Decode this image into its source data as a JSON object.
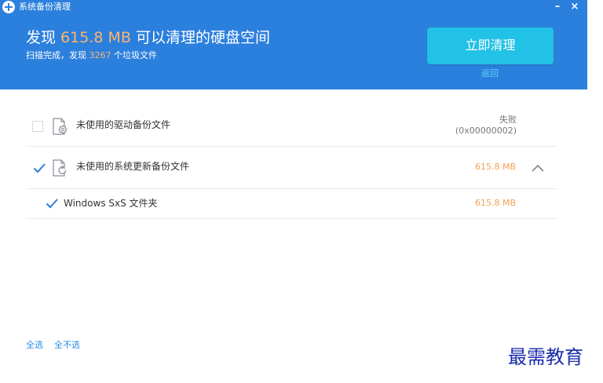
{
  "window": {
    "title": "系统备份清理",
    "minimize": "–",
    "close": "×"
  },
  "summary": {
    "headline_prefix": "发现 ",
    "headline_size": "615.8 MB",
    "headline_suffix": " 可以清理的硬盘空间",
    "sub_prefix": "扫描完成，发现 ",
    "sub_count": "3267",
    "sub_suffix": " 个垃圾文件"
  },
  "actions": {
    "clean_label": "立即清理",
    "back_label": "返回"
  },
  "items": [
    {
      "label": "未使用的驱动备份文件",
      "checked": false,
      "status_line1": "失败",
      "status_line2": "(0x00000002)",
      "icon": "gear-document-icon"
    },
    {
      "label": "未使用的系统更新备份文件",
      "checked": true,
      "size": "615.8 MB",
      "expanded": true,
      "icon": "refresh-document-icon"
    }
  ],
  "subitems": [
    {
      "label": "Windows SxS 文件夹",
      "checked": true,
      "size": "615.8 MB"
    }
  ],
  "footer": {
    "select_all": "全选",
    "select_none": "全不选"
  },
  "watermark": "最需教育",
  "colors": {
    "header_bg": "#2c80dd",
    "accent_orange": "#f5a054",
    "button_bg": "#22c1e6",
    "link_blue": "#2c8ee3",
    "check_blue": "#2a7fd8"
  }
}
